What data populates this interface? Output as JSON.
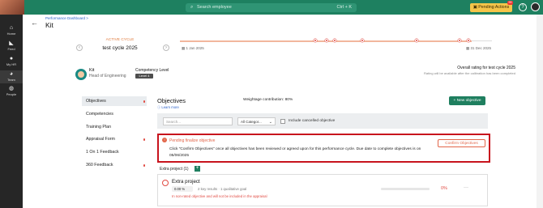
{
  "topbar": {
    "search_placeholder": "Search employee",
    "search_shortcut": "Ctrl + K",
    "pending_actions_label": "Pending Actions",
    "pending_badge": "99",
    "help_glyph": "?",
    "accent_color": "#1e8060"
  },
  "sidebar": {
    "items": [
      {
        "label": "Home",
        "icon": "home-icon"
      },
      {
        "label": "Feed",
        "icon": "megaphone-icon"
      },
      {
        "label": "My HR",
        "icon": "person-icon"
      },
      {
        "label": "Team",
        "icon": "team-icon"
      },
      {
        "label": "People",
        "icon": "people-icon"
      }
    ],
    "active_index": 3
  },
  "header": {
    "breadcrumb": "Performance Dashboard >",
    "title": "Kit",
    "back_glyph": "←"
  },
  "cycle": {
    "active_label": "ACTIVE CYCLE",
    "name": "test cycle 2025",
    "prev_glyph": "‹",
    "next_glyph": "›",
    "start_date": "1 Jan 2025",
    "end_date": "31 Dec 2025"
  },
  "employee": {
    "name": "Kit",
    "role": "Head of Engineering",
    "competency_label": "Competency Level",
    "level": "Level 4"
  },
  "rating": {
    "title": "Overall rating for test cycle 2025",
    "note": "Rating will be available after the calibration has been completed"
  },
  "menu": {
    "items": [
      {
        "label": "Objectives",
        "dot": true
      },
      {
        "label": "Competencies",
        "dot": false
      },
      {
        "label": "Training Plan",
        "dot": false
      },
      {
        "label": "Appraisal Form",
        "dot": true
      },
      {
        "label": "1 On 1 Feedback",
        "dot": false
      },
      {
        "label": "360 Feedback",
        "dot": true
      }
    ],
    "active_index": 0
  },
  "objectives": {
    "title": "Objectives",
    "learn_more": "Learn more",
    "weightage": "Weightage contribution: 80%",
    "new_button": "+ New objective",
    "search_placeholder": "Search...",
    "category_value": "All Categor...",
    "include_cancelled": "Include cancelled objective"
  },
  "pending": {
    "title": "Pending finalize objective",
    "message": "Click \"Confirm Objectives\" once all objectives has been reviewed or agreed upon for this performance cycle. Due date to complete objectives is on 05/06/2025",
    "confirm_button": "Confirm Objectives",
    "warning_color": "#e2664a",
    "highlight_color": "#c8131d"
  },
  "extra_project": {
    "section_label": "Extra project (1)",
    "add_glyph": "+",
    "name": "Extra project",
    "weight": "0.00 %",
    "key_results": "2 key results · 1 qualitative goal",
    "warning": "In non-rated objective and will not be included in the appraisal",
    "progress": "0%",
    "more_glyph": "···"
  }
}
